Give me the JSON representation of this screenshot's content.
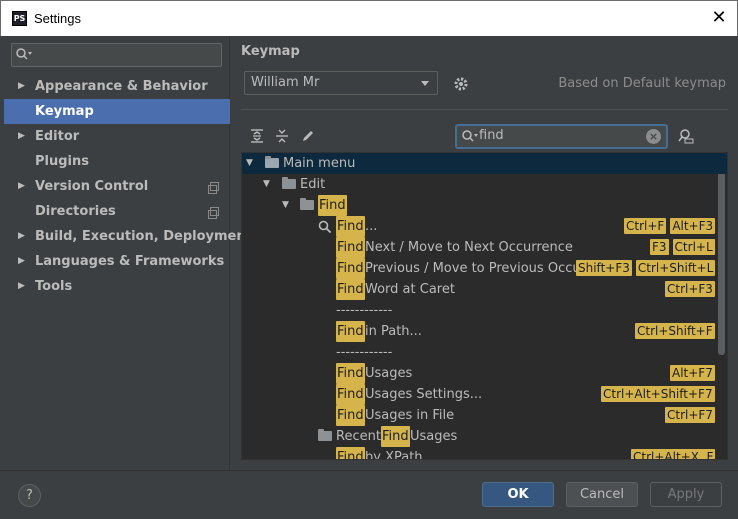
{
  "window": {
    "app_icon_text": "PS",
    "title": "Settings",
    "close_glyph": "✕"
  },
  "left": {
    "search_placeholder": "",
    "items": [
      {
        "label": "Appearance & Behavior",
        "expandable": true,
        "selected": false,
        "copy": false
      },
      {
        "label": "Keymap",
        "expandable": false,
        "selected": true,
        "copy": false
      },
      {
        "label": "Editor",
        "expandable": true,
        "selected": false,
        "copy": false
      },
      {
        "label": "Plugins",
        "expandable": false,
        "selected": false,
        "copy": false
      },
      {
        "label": "Version Control",
        "expandable": true,
        "selected": false,
        "copy": true
      },
      {
        "label": "Directories",
        "expandable": false,
        "selected": false,
        "copy": true
      },
      {
        "label": "Build, Execution, Deployment",
        "expandable": true,
        "selected": false,
        "copy": false
      },
      {
        "label": "Languages & Frameworks",
        "expandable": true,
        "selected": false,
        "copy": false
      },
      {
        "label": "Tools",
        "expandable": true,
        "selected": false,
        "copy": false
      }
    ]
  },
  "keymap": {
    "heading": "Keymap",
    "selected_keymap": "William Mr",
    "based_on": "Based on Default keymap",
    "search_value": "find",
    "clear_glyph": "×"
  },
  "tree": {
    "main_menu": "Main menu",
    "edit": "Edit",
    "find_group": "Find",
    "separator_text": "------------",
    "rows": [
      {
        "hl": "Find",
        "rest": "...",
        "keys": [
          "Ctrl+F",
          "Alt+F3"
        ]
      },
      {
        "hl": "Find",
        "rest": " Next / Move to Next Occurrence",
        "keys": [
          "F3",
          "Ctrl+L"
        ]
      },
      {
        "hl": "Find",
        "rest": " Previous / Move to Previous Occurrence",
        "keys": [
          "Shift+F3",
          "Ctrl+Shift+L"
        ]
      },
      {
        "hl": "Find",
        "rest": " Word at Caret",
        "keys": [
          "Ctrl+F3"
        ]
      },
      {
        "hl": "Find",
        "rest": " in Path...",
        "keys": [
          "Ctrl+Shift+F"
        ]
      },
      {
        "hl": "Find",
        "rest": " Usages",
        "keys": [
          "Alt+F7"
        ]
      },
      {
        "hl": "Find",
        "rest": " Usages Settings...",
        "keys": [
          "Ctrl+Alt+Shift+F7"
        ]
      },
      {
        "hl": "Find",
        "rest": " Usages in File",
        "keys": [
          "Ctrl+F7"
        ]
      }
    ],
    "recent_prefix": "Recent ",
    "recent_hl": "Find",
    "recent_suffix": " Usages",
    "xpath_hl": "Find",
    "xpath_rest": " by XPath",
    "xpath_keys": [
      "Ctrl+Alt+X, F"
    ]
  },
  "footer": {
    "help": "?",
    "ok": "OK",
    "cancel": "Cancel",
    "apply": "Apply"
  }
}
